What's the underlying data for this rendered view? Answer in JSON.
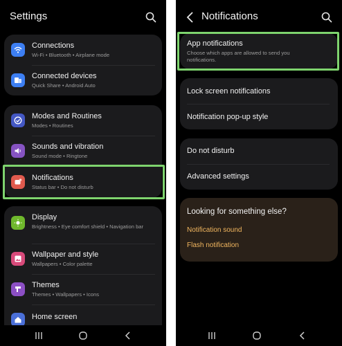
{
  "left": {
    "title": "Settings",
    "groups": [
      {
        "items": [
          {
            "title": "Connections",
            "subtitle": "Wi-Fi  •  Bluetooth  •  Airplane mode",
            "icon": "wifi-icon",
            "color": "#3d7ff3"
          },
          {
            "title": "Connected devices",
            "subtitle": "Quick Share  •  Android Auto",
            "icon": "devices-icon",
            "color": "#3d7ff3"
          }
        ]
      },
      {
        "items": [
          {
            "title": "Modes and Routines",
            "subtitle": "Modes  •  Routines",
            "icon": "check-circle-icon",
            "color": "#4458c4"
          },
          {
            "title": "Sounds and vibration",
            "subtitle": "Sound mode  •  Ringtone",
            "icon": "volume-icon",
            "color": "#8653c2"
          },
          {
            "title": "Notifications",
            "subtitle": "Status bar  •  Do not disturb",
            "icon": "bell-badge-icon",
            "color": "#e05a4e"
          }
        ]
      },
      {
        "items": [
          {
            "title": "Display",
            "subtitle": "Brightness  •  Eye comfort shield  •  Navigation bar",
            "icon": "sun-icon",
            "color": "#6fb82c"
          },
          {
            "title": "Wallpaper and style",
            "subtitle": "Wallpapers  •  Color palette",
            "icon": "image-icon",
            "color": "#d84a7a"
          },
          {
            "title": "Themes",
            "subtitle": "Themes  •  Wallpapers  •  Icons",
            "icon": "themes-icon",
            "color": "#8c4fc4"
          },
          {
            "title": "Home screen",
            "subtitle": "",
            "icon": "home-icon",
            "color": "#4a6fd8"
          }
        ]
      }
    ]
  },
  "right": {
    "title": "Notifications",
    "app_notifications": {
      "title": "App notifications",
      "subtitle": "Choose which apps are allowed to send you notifications."
    },
    "group2": [
      "Lock screen notifications",
      "Notification pop-up style"
    ],
    "group3": [
      "Do not disturb",
      "Advanced settings"
    ],
    "looking": {
      "title": "Looking for something else?",
      "links": [
        "Notification sound",
        "Flash notification"
      ]
    }
  },
  "colors": {
    "highlight": "#7ed46e",
    "link": "#f1b65f",
    "card": "#1b1b1d"
  }
}
